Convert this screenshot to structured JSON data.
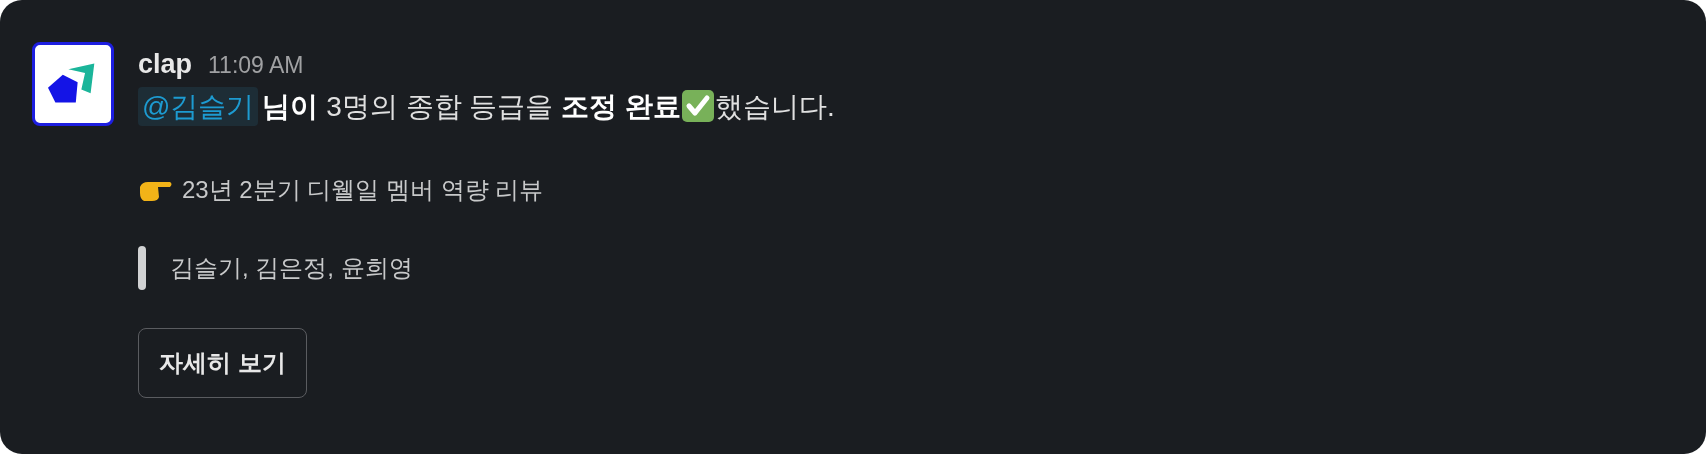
{
  "message": {
    "sender": "clap",
    "time": "11:09 AM",
    "mention": "@김슬기",
    "text_before": "**님이** 3명의 종합 등급을 **조정 완료**",
    "text_after": "했습니다.",
    "title": "23년 2분기 디웰일 멤버 역량 리뷰",
    "quote": "김슬기, 김은정, 윤희영",
    "button": "자세히 보기"
  }
}
